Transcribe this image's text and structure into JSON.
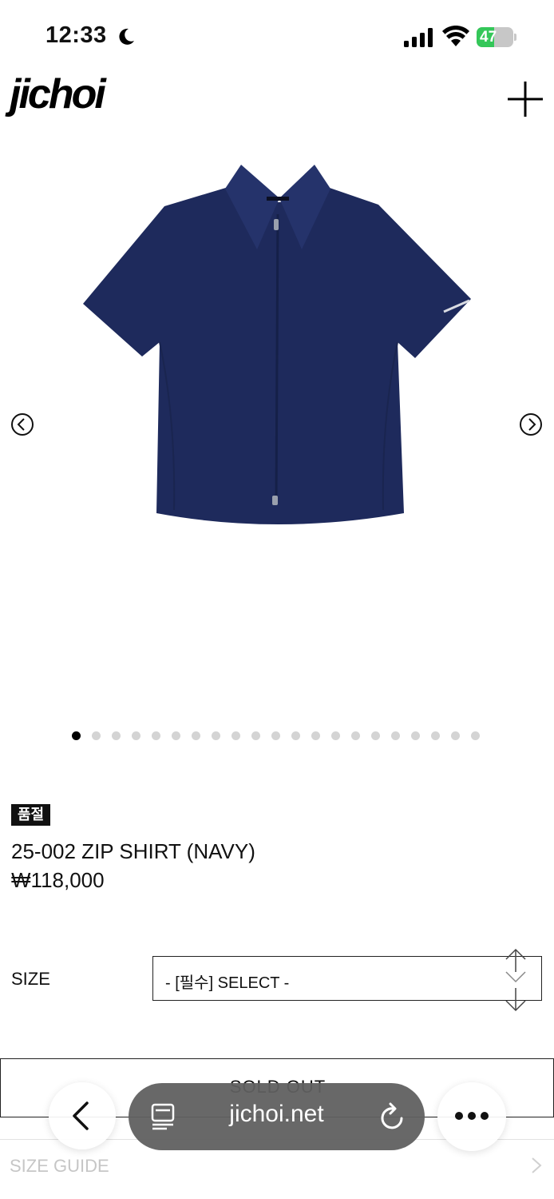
{
  "status_bar": {
    "time": "12:33",
    "battery_percent": 47,
    "battery_label": "47"
  },
  "header": {
    "logo": "jichoi"
  },
  "gallery": {
    "image_count": 21,
    "active_index": 0,
    "product_color": "#1e2a5c"
  },
  "product": {
    "badge": "품절",
    "name": "25-002 ZIP SHIRT (NAVY)",
    "price": "₩118,000"
  },
  "options": {
    "size_label": "SIZE",
    "size_select_value": "- [필수] SELECT -"
  },
  "actions": {
    "soldout_label": "SOLD OUT"
  },
  "links": {
    "size_guide": "SIZE GUIDE"
  },
  "browser": {
    "address": "jichoi.net"
  },
  "colors": {
    "battery_green": "#34c759",
    "address_bar": "#606060"
  }
}
